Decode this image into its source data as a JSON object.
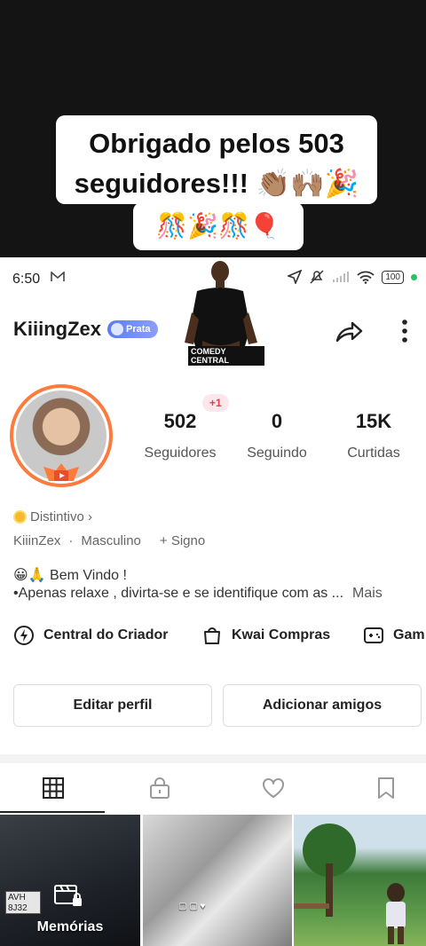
{
  "overlay": {
    "caption_line1": "Obrigado pelos 503",
    "caption_line2": "seguidores!!! 👏🏽🙌🏽🎉",
    "caption_line3": "🎊🎉🎊🎈"
  },
  "status_bar": {
    "time": "6:50",
    "battery": "100",
    "mail_icon": "mail-icon",
    "accent_dot_color": "#22c55e"
  },
  "header": {
    "username": "KiiingZex",
    "badge": "Prata",
    "badge_color": "#5c7cf0",
    "sticker_label": "COMEDY CENTRAL"
  },
  "profile": {
    "new_followers_badge": "+1",
    "stats": [
      {
        "value": "502",
        "label": "Seguidores"
      },
      {
        "value": "0",
        "label": "Seguindo"
      },
      {
        "value": "15K",
        "label": "Curtidas"
      }
    ],
    "distintivo": "Distintivo ›",
    "info": [
      "KiiinZex",
      "·",
      "Masculino",
      "+ Signo"
    ],
    "bio_line1": "😀🙏 Bem Vindo !",
    "bio_line2": "•Apenas relaxe , divirta-se e se identifique com as ...",
    "bio_more": "Mais"
  },
  "quick_links": [
    {
      "label": "Central do Criador",
      "icon": "lightning-icon"
    },
    {
      "label": "Kwai Compras",
      "icon": "shopping-bag-icon"
    },
    {
      "label": "Gam",
      "icon": "gamepad-icon"
    }
  ],
  "actions": {
    "edit": "Editar perfil",
    "add_friends": "Adicionar amigos"
  },
  "tabs": [
    {
      "name": "grid-icon"
    },
    {
      "name": "lock-icon"
    },
    {
      "name": "heart-icon"
    },
    {
      "name": "bookmark-icon"
    }
  ],
  "grid": {
    "memorias_label": "Memórias",
    "plate_text": "AVH 8J32"
  }
}
